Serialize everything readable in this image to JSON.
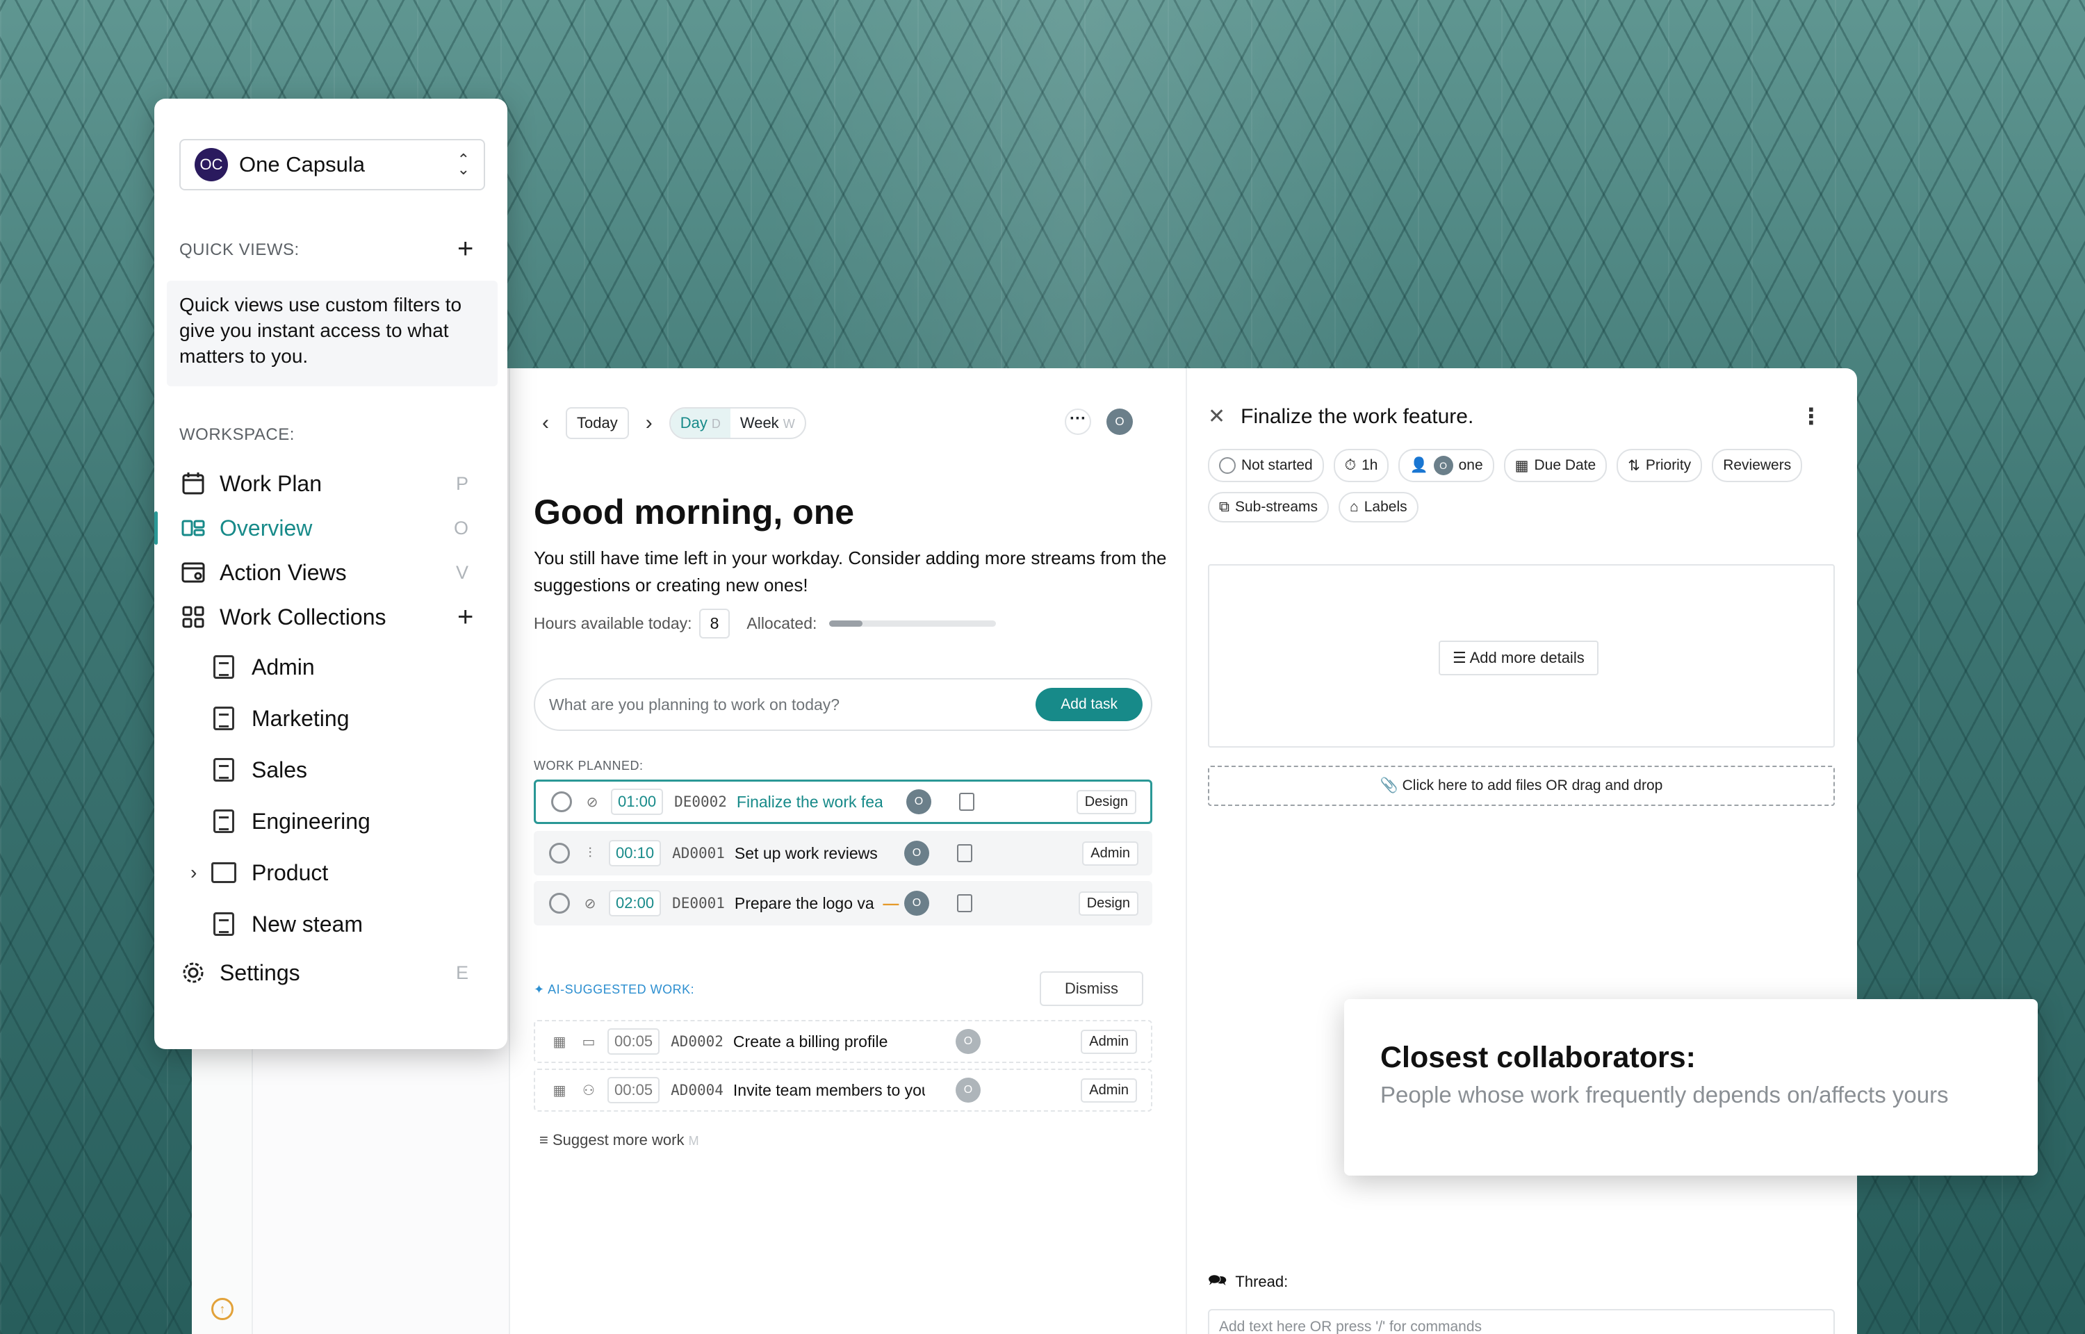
{
  "workspace": {
    "logo": "OC",
    "name": "One Capsula"
  },
  "quick_views": {
    "label": "QUICK VIEWS:",
    "note": "Quick views use custom filters to give you instant access to what matters to you."
  },
  "workspace_nav": {
    "label": "WORKSPACE:",
    "items": [
      {
        "label": "Work Plan",
        "key": "P",
        "icon": "calendar-icon"
      },
      {
        "label": "Overview",
        "key": "O",
        "icon": "overview-icon",
        "active": true
      },
      {
        "label": "Action Views",
        "key": "V",
        "icon": "action-views-icon"
      },
      {
        "label": "Work Collections",
        "key": "",
        "icon": "grid-icon"
      }
    ],
    "collections": [
      {
        "label": "Admin",
        "icon": "clipboard-icon"
      },
      {
        "label": "Marketing",
        "icon": "document-icon"
      },
      {
        "label": "Sales",
        "icon": "document-icon"
      },
      {
        "label": "Engineering",
        "icon": "document-icon"
      },
      {
        "label": "Product",
        "icon": "folder-icon"
      },
      {
        "label": "New steam",
        "icon": "document-icon"
      }
    ],
    "settings": {
      "label": "Settings",
      "key": "E"
    }
  },
  "topbar": {
    "today": "Today",
    "day": "Day",
    "day_key": "D",
    "week": "Week",
    "week_key": "W",
    "avatar": "O"
  },
  "greeting": {
    "title": "Good morning,  one",
    "subtitle": "You still have time left in your workday. Consider adding more streams from the suggestions or creating new ones!",
    "hours_label": "Hours available today:",
    "hours_value": "8",
    "allocated_label": "Allocated:",
    "allocated_fraction": 0.2
  },
  "plan_input": {
    "placeholder": "What are you planning to work on today?",
    "button": "Add task"
  },
  "work_planned": {
    "label": "WORK PLANNED:",
    "tasks": [
      {
        "time": "01:00",
        "code": "DE0002",
        "name": "Finalize the work feat",
        "avatar": "O",
        "tag": "Design",
        "icon": "check-circle-icon",
        "active": true
      },
      {
        "time": "00:10",
        "code": "AD0001",
        "name": "Set up work reviews",
        "avatar": "O",
        "tag": "Admin",
        "icon": "sliders-icon"
      },
      {
        "time": "02:00",
        "code": "DE0001",
        "name": "Prepare the logo va",
        "avatar": "O",
        "tag": "Design",
        "icon": "check-circle-icon",
        "priority": "—"
      }
    ]
  },
  "ai_suggested": {
    "label": "AI-SUGGESTED WORK:",
    "dismiss": "Dismiss",
    "tasks": [
      {
        "time": "00:05",
        "code": "AD0002",
        "name": "Create a billing profile",
        "avatar": "O",
        "tag": "Admin"
      },
      {
        "time": "00:05",
        "code": "AD0004",
        "name": "Invite team members to you",
        "avatar": "O",
        "tag": "Admin"
      }
    ],
    "suggest_more": "Suggest more work",
    "suggest_key": "M"
  },
  "detail": {
    "title": "Finalize the work feature.",
    "status": "Not started",
    "duration": "1h",
    "assignee_avatar": "O",
    "assignee": "one",
    "due": "Due Date",
    "priority": "Priority",
    "reviewers": "Reviewers",
    "substreams": "Sub-streams",
    "labels": "Labels",
    "add_details": "Add more details",
    "files": "Click here to add files OR drag and drop",
    "thread": "Thread:",
    "thread_placeholder": "Add text here OR press '/' for commands"
  },
  "collaborators": {
    "title": "Closest collaborators:",
    "subtitle": "People whose work frequently depends on/affects yours"
  },
  "colors": {
    "accent": "#178a89",
    "background": "#3f7774"
  }
}
